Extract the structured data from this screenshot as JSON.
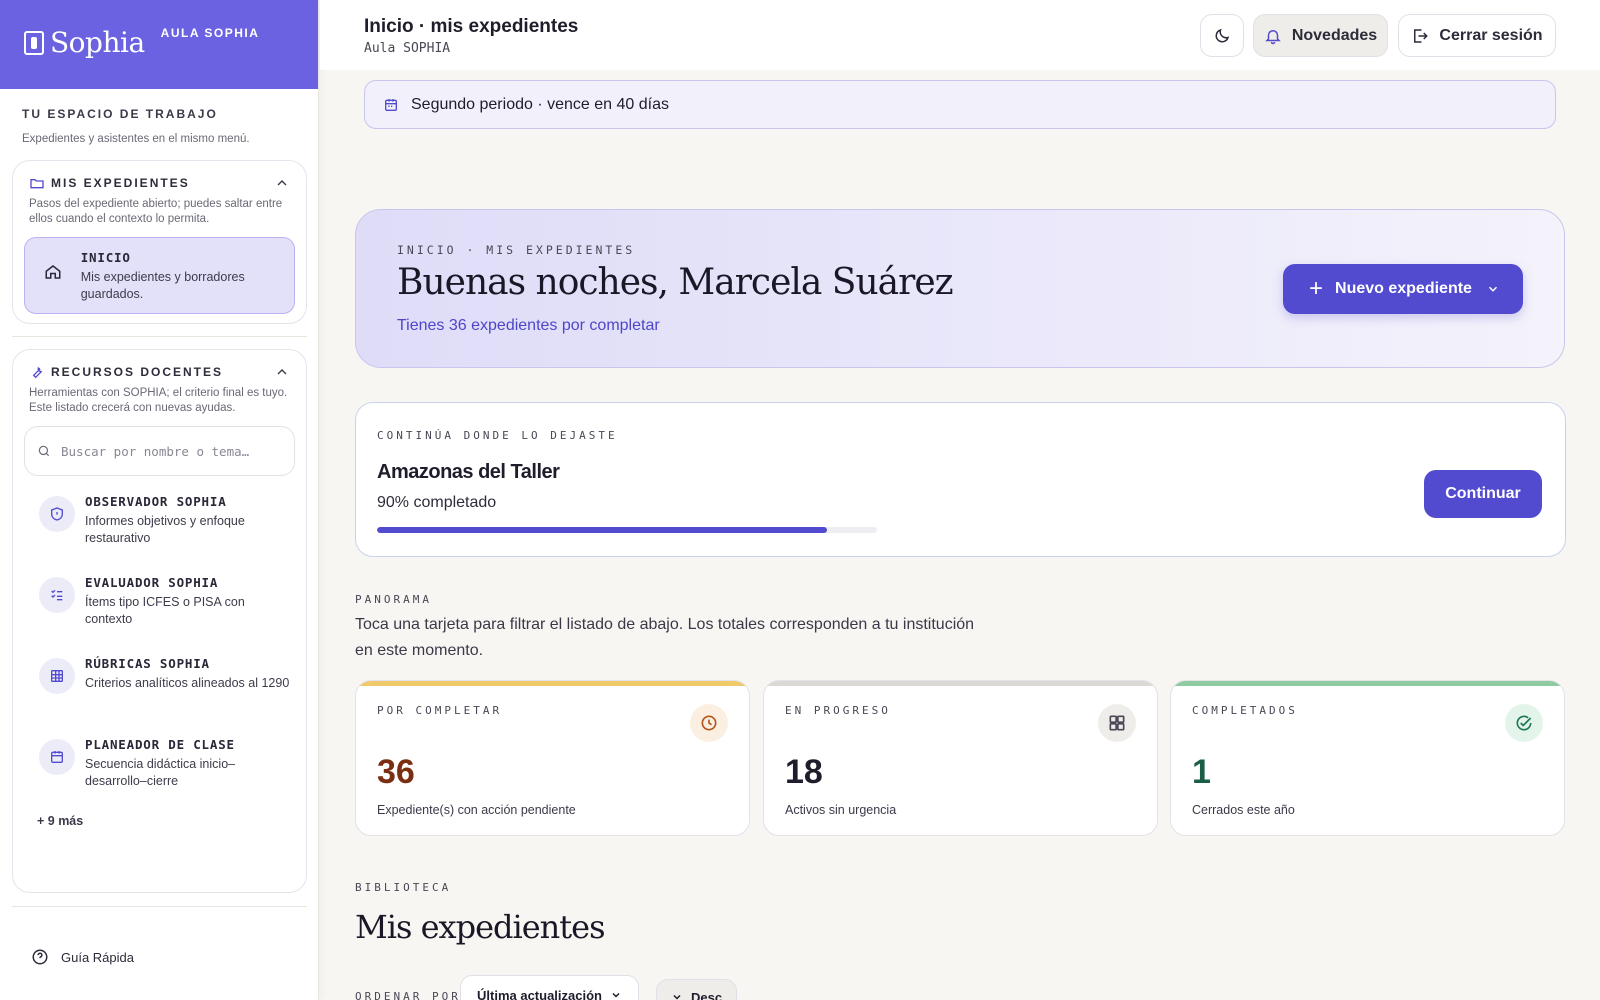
{
  "brand": {
    "name": "Sophia",
    "tag": "AULA SOPHIA"
  },
  "sidebar": {
    "workspace_title": "TU ESPACIO DE TRABAJO",
    "workspace_sub": "Expedientes y asistentes en el mismo menú.",
    "expedientes": {
      "title": "MIS EXPEDIENTES",
      "desc": "Pasos del expediente abierto; puedes saltar entre ellos cuando el contexto lo permita.",
      "active_item": {
        "title": "INICIO",
        "sub": "Mis expedientes y borradores guardados."
      }
    },
    "recursos": {
      "title": "RECURSOS DOCENTES",
      "desc": "Herramientas con SOPHIA; el criterio final es tuyo. Este listado crecerá con nuevas ayudas.",
      "search_placeholder": "Buscar por nombre o tema…",
      "items": [
        {
          "title": "OBSERVADOR SOPHIA",
          "sub": "Informes objetivos y enfoque restaurativo",
          "icon": "shield-icon"
        },
        {
          "title": "EVALUADOR SOPHIA",
          "sub": "Ítems tipo ICFES o PISA con contexto",
          "icon": "checklist-icon"
        },
        {
          "title": "RÚBRICAS SOPHIA",
          "sub": "Criterios analíticos alineados al 1290",
          "icon": "grid-icon"
        },
        {
          "title": "PLANEADOR DE CLASE",
          "sub": "Secuencia didáctica inicio–desarrollo–cierre",
          "icon": "calendar-icon"
        }
      ],
      "more": "+ 9 más"
    },
    "guide": "Guía Rápida"
  },
  "header": {
    "title": "Inicio · mis expedientes",
    "subtitle": "Aula SOPHIA",
    "news_label": "Novedades",
    "logout_label": "Cerrar sesión"
  },
  "banner": "Segundo periodo · vence en 40 días",
  "hero": {
    "eyebrow": "INICIO · MIS EXPEDIENTES",
    "greeting": "Buenas noches, Marcela Suárez",
    "count": "Tienes 36 expedientes por completar",
    "new_button": "Nuevo expediente"
  },
  "continue": {
    "eyebrow": "CONTINÚA DONDE LO DEJASTE",
    "name": "Amazonas del Taller",
    "pct_label": "90% completado",
    "progress": 0.9,
    "button": "Continuar"
  },
  "panorama": {
    "eyebrow": "PANORAMA",
    "text": "Toca una tarjeta para filtrar el listado de abajo. Los totales corresponden a tu institución en este momento."
  },
  "stats": [
    {
      "label": "POR COMPLETAR",
      "value": "36",
      "desc": "Expediente(s) con acción pendiente",
      "color": "#7a2e12",
      "bar": "#f0c96a",
      "icon_bg": "#fbefe2",
      "icon": "clock-icon"
    },
    {
      "label": "EN PROGRESO",
      "value": "18",
      "desc": "Activos sin urgencia",
      "color": "#1f1d2b",
      "bar": "#dcd9d4",
      "icon_bg": "#efedea",
      "icon": "grid-icon"
    },
    {
      "label": "COMPLETADOS",
      "value": "1",
      "desc": "Cerrados este año",
      "color": "#1b5e48",
      "bar": "#8ccca0",
      "icon_bg": "#e3f4ea",
      "icon": "check-circle-icon"
    }
  ],
  "library": {
    "eyebrow": "BIBLIOTECA",
    "title": "Mis expedientes",
    "order_label": "ORDENAR POR",
    "order_value": "Última actualización",
    "dir_label": "Desc"
  },
  "colors": {
    "accent": "#524bd0",
    "brand": "#6a62e0"
  }
}
